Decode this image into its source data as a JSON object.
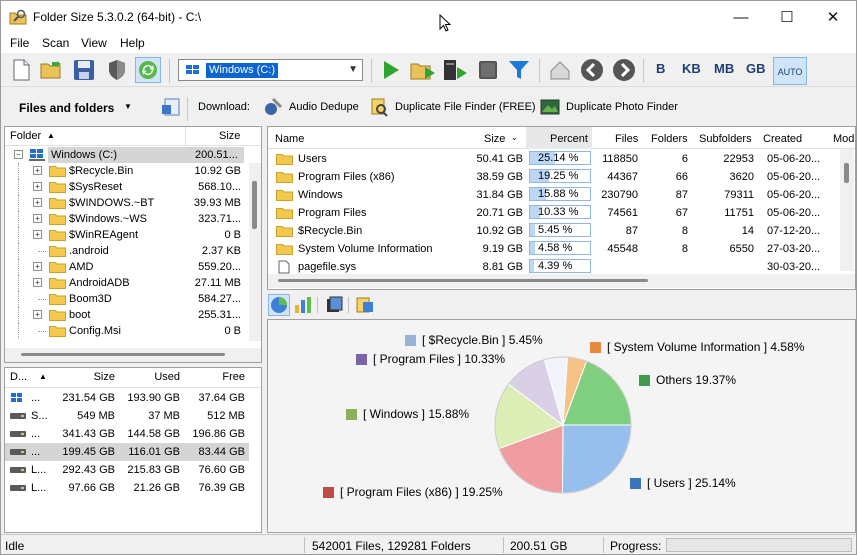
{
  "window": {
    "title": "Folder Size 5.3.0.2 (64-bit) - C:\\",
    "minimize": "—",
    "maximize": "☐",
    "close": "✕"
  },
  "menu": [
    "File",
    "Scan",
    "View",
    "Help"
  ],
  "toolbar": {
    "drive_selected": "Windows (C:)",
    "units": [
      "B",
      "KB",
      "MB",
      "GB"
    ],
    "auto": "AUTO"
  },
  "toolbar2": {
    "files_and_folders": "Files and folders",
    "download_label": "Download:",
    "audio_dedupe": "Audio Dedupe",
    "duplicate_file_finder": "Duplicate File Finder (FREE)",
    "duplicate_photo_finder": "Duplicate Photo Finder"
  },
  "tree": {
    "headers": {
      "folder": "Folder",
      "size": "Size"
    },
    "root": {
      "name": "Windows (C:)",
      "size": "200.51..."
    },
    "items": [
      {
        "name": "$Recycle.Bin",
        "size": "10.92 GB",
        "expandable": true
      },
      {
        "name": "$SysReset",
        "size": "568.10...",
        "expandable": true
      },
      {
        "name": "$WINDOWS.~BT",
        "size": "39.93 MB",
        "expandable": true
      },
      {
        "name": "$Windows.~WS",
        "size": "323.71...",
        "expandable": true
      },
      {
        "name": "$WinREAgent",
        "size": "0 B",
        "expandable": true
      },
      {
        "name": ".android",
        "size": "2.37 KB",
        "expandable": false
      },
      {
        "name": "AMD",
        "size": "559.20...",
        "expandable": true
      },
      {
        "name": "AndroidADB",
        "size": "27.11 MB",
        "expandable": true
      },
      {
        "name": "Boom3D",
        "size": "584.27...",
        "expandable": false
      },
      {
        "name": "boot",
        "size": "255.31...",
        "expandable": true
      },
      {
        "name": "Config.Msi",
        "size": "0 B",
        "expandable": false
      }
    ]
  },
  "drives": {
    "headers": {
      "drive": "D...",
      "size": "Size",
      "used": "Used",
      "free": "Free"
    },
    "rows": [
      {
        "name": "...",
        "size": "231.54 GB",
        "used": "193.90 GB",
        "free": "37.64 GB",
        "selected": false
      },
      {
        "name": "S...",
        "size": "549 MB",
        "used": "37 MB",
        "free": "512 MB",
        "selected": false
      },
      {
        "name": "...",
        "size": "341.43 GB",
        "used": "144.58 GB",
        "free": "196.86 GB",
        "selected": false
      },
      {
        "name": "...",
        "size": "199.45 GB",
        "used": "116.01 GB",
        "free": "83.44 GB",
        "selected": true
      },
      {
        "name": "L...",
        "size": "292.43 GB",
        "used": "215.83 GB",
        "free": "76.60 GB",
        "selected": false
      },
      {
        "name": "L...",
        "size": "97.66 GB",
        "used": "21.26 GB",
        "free": "76.39 GB",
        "selected": false
      }
    ]
  },
  "list": {
    "headers": {
      "name": "Name",
      "size": "Size",
      "percent": "Percent",
      "files": "Files",
      "folders": "Folders",
      "subfolders": "Subfolders",
      "created": "Created",
      "modified": "Modi"
    },
    "rows": [
      {
        "name": "Users",
        "size": "50.41 GB",
        "percent": "25.14 %",
        "pct": 25.14,
        "files": "118850",
        "folders": "6",
        "subfolders": "22953",
        "created": "05-06-20...",
        "icon": "folder"
      },
      {
        "name": "Program Files (x86)",
        "size": "38.59 GB",
        "percent": "19.25 %",
        "pct": 19.25,
        "files": "44367",
        "folders": "66",
        "subfolders": "3620",
        "created": "05-06-20...",
        "icon": "folder"
      },
      {
        "name": "Windows",
        "size": "31.84 GB",
        "percent": "15.88 %",
        "pct": 15.88,
        "files": "230790",
        "folders": "87",
        "subfolders": "79311",
        "created": "05-06-20...",
        "icon": "folder"
      },
      {
        "name": "Program Files",
        "size": "20.71 GB",
        "percent": "10.33 %",
        "pct": 10.33,
        "files": "74561",
        "folders": "67",
        "subfolders": "11751",
        "created": "05-06-20...",
        "icon": "folder"
      },
      {
        "name": "$Recycle.Bin",
        "size": "10.92 GB",
        "percent": "5.45 %",
        "pct": 5.45,
        "files": "87",
        "folders": "8",
        "subfolders": "14",
        "created": "07-12-20...",
        "icon": "folder"
      },
      {
        "name": "System Volume Information",
        "size": "9.19 GB",
        "percent": "4.58 %",
        "pct": 4.58,
        "files": "45548",
        "folders": "8",
        "subfolders": "6550",
        "created": "27-03-20...",
        "icon": "folder"
      },
      {
        "name": "pagefile.sys",
        "size": "8.81 GB",
        "percent": "4.39 %",
        "pct": 4.39,
        "files": "",
        "folders": "",
        "subfolders": "",
        "created": "30-03-20...",
        "icon": "file"
      }
    ]
  },
  "chart_data": {
    "type": "pie",
    "slices": [
      {
        "label": "[ Users ] 25.14%",
        "value": 25.14,
        "color": "#97bfee"
      },
      {
        "label": "[ Program Files (x86) ] 19.25%",
        "value": 19.25,
        "color": "#f09da1"
      },
      {
        "label": "[ Windows ] 15.88%",
        "value": 15.88,
        "color": "#dcedb6"
      },
      {
        "label": "[ Program Files ] 10.33%",
        "value": 10.33,
        "color": "#d9d0e8"
      },
      {
        "label": "[ $Recycle.Bin ] 5.45%",
        "value": 5.45,
        "color": "#f2f4fb"
      },
      {
        "label": "[ System Volume Information ] 4.58%",
        "value": 4.58,
        "color": "#f7c286"
      },
      {
        "label": "Others 19.37%",
        "value": 19.37,
        "color": "#80cf80"
      }
    ],
    "legend_colors": {
      "users": "#3b74b8",
      "program_files_x86": "#be4b48",
      "windows": "#8cb05a",
      "program_files": "#7a64a3",
      "recycle_bin": "#98b3d8",
      "system_volume": "#e88a3c",
      "others": "#3f9a4e"
    }
  },
  "status": {
    "state": "Idle",
    "summary": "542001 Files, 129281 Folders",
    "total": "200.51 GB",
    "progress_label": "Progress:"
  }
}
